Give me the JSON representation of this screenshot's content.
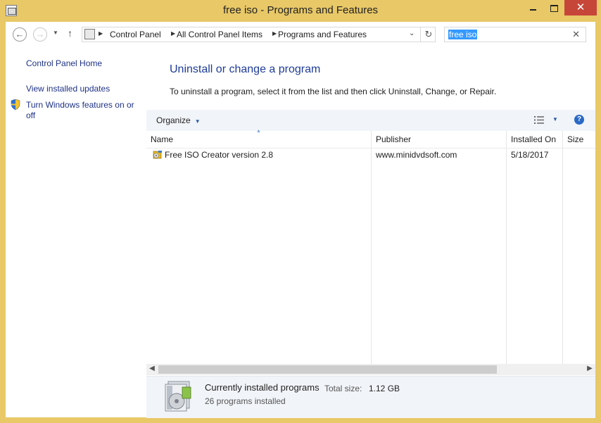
{
  "window": {
    "title": "free iso - Programs and Features",
    "close_glyph": "✕"
  },
  "nav": {
    "back_glyph": "←",
    "forward_glyph": "→",
    "up_glyph": "↑",
    "breadcrumbs": [
      "Control Panel",
      "All Control Panel Items",
      "Programs and Features"
    ]
  },
  "search": {
    "value": "free iso",
    "clear_glyph": "✕"
  },
  "sidebar": {
    "items": [
      {
        "label": "Control Panel Home"
      },
      {
        "label": "View installed updates"
      },
      {
        "label": "Turn Windows features on or off",
        "icon": "shield-icon"
      }
    ]
  },
  "main": {
    "heading": "Uninstall or change a program",
    "subtext": "To uninstall a program, select it from the list and then click Uninstall, Change, or Repair."
  },
  "toolbar": {
    "organize_label": "Organize",
    "help_glyph": "?"
  },
  "columns": [
    "Name",
    "Publisher",
    "Installed On",
    "Size"
  ],
  "programs": [
    {
      "name": "Free ISO Creator version 2.8",
      "publisher": "www.minidvdsoft.com",
      "installed_on": "5/18/2017",
      "size": ""
    }
  ],
  "details": {
    "title": "Currently installed programs",
    "total_size_label": "Total size:",
    "total_size_value": "1.12 GB",
    "count_text": "26 programs installed"
  },
  "colors": {
    "frame": "#e8c867",
    "close_button": "#c7463a",
    "link": "#1e3287",
    "heading": "#1e3c96",
    "toolbar_bg": "#f1f4f8",
    "selection": "#3399ff"
  }
}
